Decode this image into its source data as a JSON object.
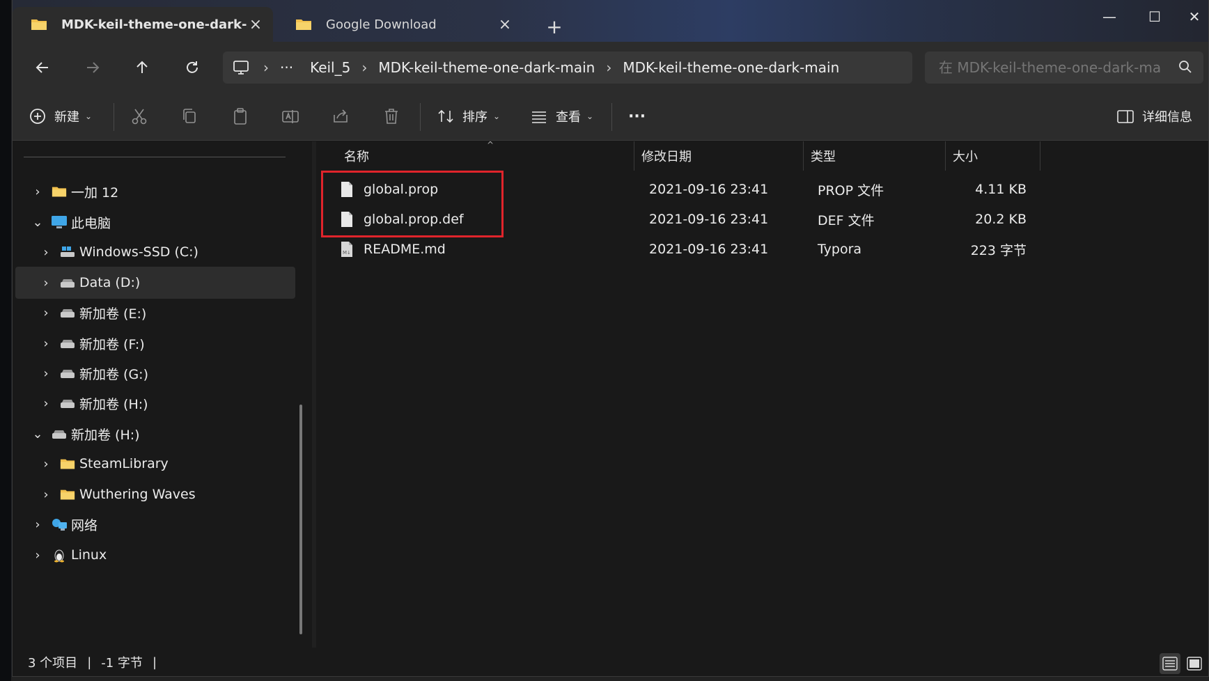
{
  "tabs": [
    {
      "label": "MDK-keil-theme-one-dark-ma",
      "active": true
    },
    {
      "label": "Google Download",
      "active": false
    }
  ],
  "window_controls": {
    "minimize": "—",
    "maximize": "☐",
    "close": "✕"
  },
  "address": {
    "overflow": "···",
    "crumbs": [
      "Keil_5",
      "MDK-keil-theme-one-dark-main",
      "MDK-keil-theme-one-dark-main"
    ]
  },
  "search": {
    "placeholder": "在 MDK-keil-theme-one-dark-mai"
  },
  "commands": {
    "new_label": "新建",
    "sort_label": "排序",
    "view_label": "查看",
    "more": "···",
    "details_label": "详细信息"
  },
  "sidebar": {
    "items": [
      {
        "label": "一加 12",
        "expanded": false,
        "icon": "folder-icon"
      },
      {
        "label": "此电脑",
        "expanded": true,
        "icon": "computer-icon"
      },
      {
        "label": "Windows-SSD (C:)",
        "expanded": false,
        "icon": "windows-drive-icon"
      },
      {
        "label": "Data (D:)",
        "expanded": false,
        "icon": "drive-icon",
        "selected": true
      },
      {
        "label": "新加卷 (E:)",
        "expanded": false,
        "icon": "drive-icon"
      },
      {
        "label": "新加卷 (F:)",
        "expanded": false,
        "icon": "drive-icon"
      },
      {
        "label": "新加卷 (G:)",
        "expanded": false,
        "icon": "drive-icon"
      },
      {
        "label": "新加卷 (H:)",
        "expanded": false,
        "icon": "drive-icon"
      },
      {
        "label": "新加卷 (H:)",
        "expanded": true,
        "icon": "drive-icon"
      },
      {
        "label": "SteamLibrary",
        "expanded": false,
        "icon": "folder-icon"
      },
      {
        "label": "Wuthering Waves",
        "expanded": false,
        "icon": "folder-icon"
      },
      {
        "label": "网络",
        "expanded": false,
        "icon": "network-icon"
      },
      {
        "label": "Linux",
        "expanded": false,
        "icon": "linux-icon"
      }
    ]
  },
  "columns": {
    "name": "名称",
    "modified": "修改日期",
    "type": "类型",
    "size": "大小"
  },
  "files": [
    {
      "name": "global.prop",
      "modified": "2021-09-16 23:41",
      "type": "PROP 文件",
      "size": "4.11 KB"
    },
    {
      "name": "global.prop.def",
      "modified": "2021-09-16 23:41",
      "type": "DEF 文件",
      "size": "20.2 KB"
    },
    {
      "name": "README.md",
      "modified": "2021-09-16 23:41",
      "type": "Typora",
      "size": "223 字节"
    }
  ],
  "status": {
    "count": "3 个项目",
    "size": "-1 字节"
  },
  "colors": {
    "highlight": "#e0242b",
    "folder": "#f2c14e",
    "accent": "#4aa3ff"
  }
}
